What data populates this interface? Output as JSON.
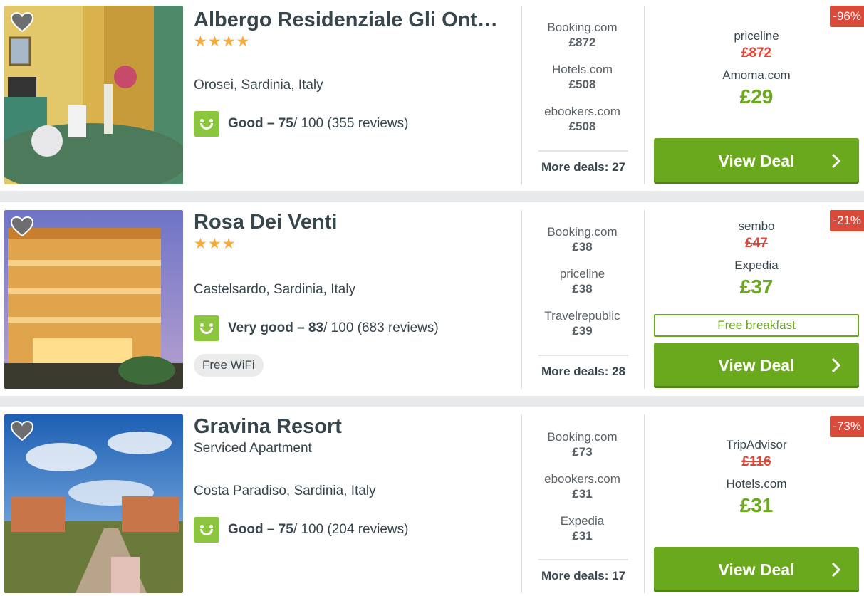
{
  "results": [
    {
      "name": "Albergo Residenziale Gli Ont…",
      "stars": "★★★★",
      "subtype": "",
      "location": "Orosei, Sardinia, Italy",
      "rating_label": "Good – 75",
      "rating_suffix": " / 100 (355 reviews)",
      "amenity": "",
      "deals": [
        {
          "source": "Booking.com",
          "price": "£872"
        },
        {
          "source": "Hotels.com",
          "price": "£508"
        },
        {
          "source": "ebookers.com",
          "price": "£508"
        }
      ],
      "more_deals": "More deals: 27",
      "best": {
        "source1": "priceline",
        "old_price": "£872",
        "source2": "Amoma.com",
        "price": "£29"
      },
      "discount_badge": "-96%",
      "free_breakfast": "",
      "view_deal_label": "View Deal"
    },
    {
      "name": "Rosa Dei Venti",
      "stars": "★★★",
      "subtype": "",
      "location": "Castelsardo, Sardinia, Italy",
      "rating_label": "Very good – 83",
      "rating_suffix": " / 100 (683 reviews)",
      "amenity": "Free WiFi",
      "deals": [
        {
          "source": "Booking.com",
          "price": "£38"
        },
        {
          "source": "priceline",
          "price": "£38"
        },
        {
          "source": "Travelrepublic",
          "price": "£39"
        }
      ],
      "more_deals": "More deals: 28",
      "best": {
        "source1": "sembo",
        "old_price": "£47",
        "source2": "Expedia",
        "price": "£37"
      },
      "discount_badge": "-21%",
      "free_breakfast": "Free breakfast",
      "view_deal_label": "View Deal"
    },
    {
      "name": "Gravina Resort",
      "stars": "",
      "subtype": "Serviced Apartment",
      "location": "Costa Paradiso, Sardinia, Italy",
      "rating_label": "Good – 75",
      "rating_suffix": " / 100 (204 reviews)",
      "amenity": "",
      "deals": [
        {
          "source": "Booking.com",
          "price": "£73"
        },
        {
          "source": "ebookers.com",
          "price": "£31"
        },
        {
          "source": "Expedia",
          "price": "£31"
        }
      ],
      "more_deals": "More deals: 17",
      "best": {
        "source1": "TripAdvisor",
        "old_price": "£116",
        "source2": "Hotels.com",
        "price": "£31"
      },
      "discount_badge": "-73%",
      "free_breakfast": "",
      "view_deal_label": "View Deal"
    }
  ],
  "icons": {
    "favorite": "heart-icon",
    "rating": "smiley-rating-icon",
    "view_deal": "chevron-right-icon"
  },
  "colors": {
    "accent_green": "#6aa81d",
    "rating_green": "#8cc63f",
    "badge_red": "#d94a3b",
    "star_orange": "#f6ab3f"
  }
}
